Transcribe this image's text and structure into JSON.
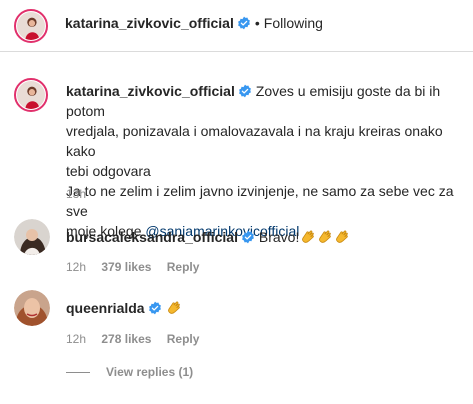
{
  "post_header": {
    "username": "katarina_zivkovic_official",
    "separator": "•",
    "follow_status": "Following"
  },
  "caption": {
    "username": "katarina_zivkovic_official",
    "line1": "Zoves u emisiju goste da bi ih potom",
    "line2": "vredjala, ponizavala i omalovazavala i na kraju kreiras onako kako",
    "line3": "tebi odgovara",
    "line4": "Ja to ne zelim i zelim javno izvinjenje, ne samo za sebe vec za sve",
    "line5_prefix": "moje kolege ",
    "mention": "@sanjamarinkovicofficial",
    "time": "13h"
  },
  "comments": [
    {
      "username": "bursacaleksandra_official",
      "text": "Bravo!",
      "reaction_icon": "clapping-hands-emoji",
      "reaction_count_visible": 3,
      "time": "12h",
      "likes": "379 likes",
      "reply": "Reply"
    },
    {
      "username": "queenrialda",
      "text": "",
      "reaction_icon": "clapping-hands-emoji",
      "reaction_count_visible": 1,
      "time": "12h",
      "likes": "278 likes",
      "reply": "Reply"
    }
  ],
  "view_replies": "View replies (1)",
  "colors": {
    "verified": "#3897f0",
    "mention": "#00376b",
    "muted": "#8e8e8e",
    "story_ring": "#e1306c",
    "clap": "#f5b82e"
  }
}
